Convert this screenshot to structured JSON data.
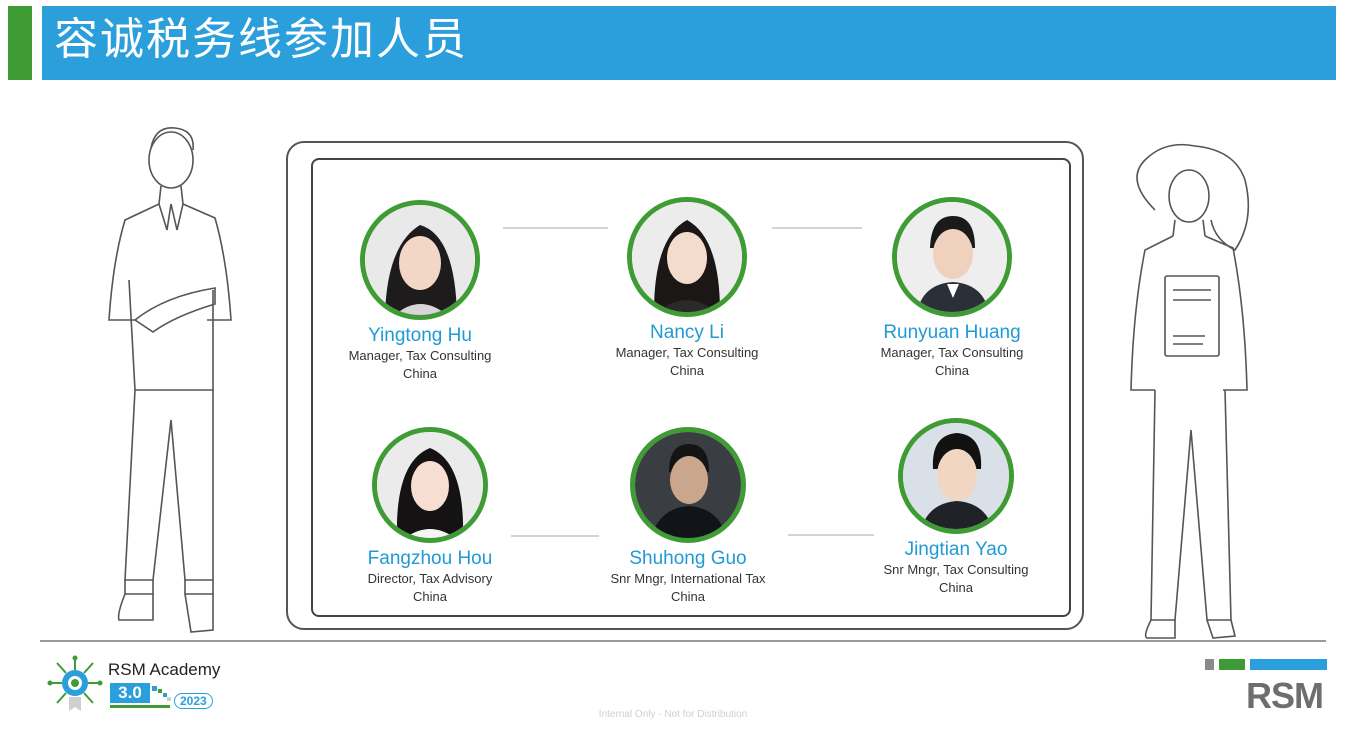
{
  "header": {
    "title": "容诚税务线参加人员"
  },
  "people": [
    {
      "name": "Yingtong Hu",
      "role": "Manager, Tax Consulting",
      "country": "China"
    },
    {
      "name": "Nancy Li",
      "role": "Manager, Tax Consulting",
      "country": "China"
    },
    {
      "name": "Runyuan Huang",
      "role": "Manager, Tax Consulting",
      "country": "China"
    },
    {
      "name": "Fangzhou Hou",
      "role": "Director, Tax Advisory",
      "country": "China"
    },
    {
      "name": "Shuhong Guo",
      "role": "Snr Mngr, International Tax",
      "country": "China"
    },
    {
      "name": "Jingtian Yao",
      "role": "Snr Mngr, Tax Consulting",
      "country": "China"
    }
  ],
  "footer": {
    "academy_title": "RSM Academy",
    "academy_version": "3.0",
    "academy_year": "2023",
    "note": "Internal Only - Not for Distribution",
    "brand": "RSM"
  },
  "colors": {
    "accent_blue": "#2a9fdb",
    "accent_green": "#3f9c35",
    "name_blue": "#1f9ad6"
  },
  "icons": [
    "man-illustration",
    "woman-illustration",
    "rsm-academy-logo",
    "rsm-logo"
  ]
}
